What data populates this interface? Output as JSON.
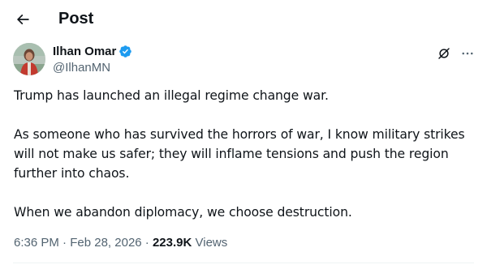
{
  "header": {
    "back_icon": "arrow-left-icon",
    "title": "Post"
  },
  "author": {
    "display_name": "Ilhan Omar",
    "handle": "@IlhanMN",
    "verified_icon": "verified-badge-icon",
    "verified_color": "#1d9bf0",
    "avatar": "profile-photo"
  },
  "actions": {
    "grok_icon": "grok-icon",
    "more_icon": "more-horizontal-icon"
  },
  "tweet": {
    "paragraphs": [
      "Trump has launched an illegal regime change war.",
      "As someone who has survived the horrors of war, I know military strikes\nwill not make us safer; they will inflame tensions and push the region\nfurther into chaos.",
      "When we abandon diplomacy, we choose destruction."
    ]
  },
  "meta": {
    "time": "6:36 PM",
    "separator": " · ",
    "date": "Feb 28, 2026",
    "views_count": "223.9K",
    "views_label": " Views"
  },
  "colors": {
    "text_primary": "#0f1419",
    "text_secondary": "#536471",
    "accent": "#1d9bf0",
    "divider": "#eff3f4"
  }
}
